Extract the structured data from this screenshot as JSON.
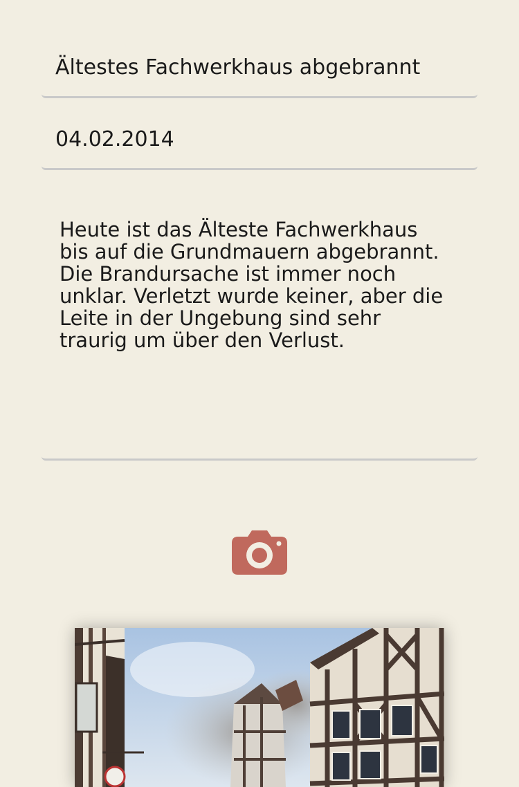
{
  "article": {
    "title": "Ältestes Fachwerkhaus abgebrannt",
    "date": "04.02.2014",
    "body": "Heute ist das Älteste Fachwerkhaus\nbis auf die Grundmauern abgebrannt.\nDie Brandursache ist immer noch\nunklar. Verletzt wurde keiner, aber die\nLeite in der Ungebung sind sehr\ntraurig um über den Verlust."
  },
  "camera": {
    "icon": "camera-icon",
    "color": "#c0695d"
  },
  "colors": {
    "background": "#f2eee2",
    "field_underline": "#c9c9c9",
    "text": "#1a1a1a"
  }
}
